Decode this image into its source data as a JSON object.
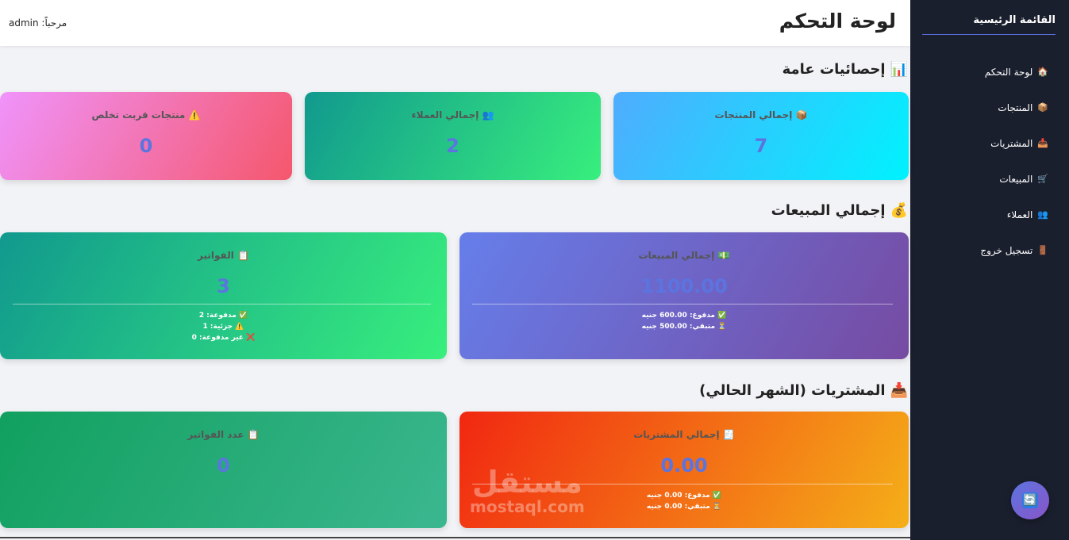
{
  "sidebar": {
    "title": "القائمة الرئيسية",
    "items": [
      {
        "icon": "🏠",
        "label": "لوحة التحكم"
      },
      {
        "icon": "📦",
        "label": "المنتجات"
      },
      {
        "icon": "📥",
        "label": "المشتريات"
      },
      {
        "icon": "🛒",
        "label": "المبيعات"
      },
      {
        "icon": "👥",
        "label": "العملاء"
      },
      {
        "icon": "🚪",
        "label": "تسجيل خروج"
      }
    ]
  },
  "header": {
    "title": "لوحة التحكم",
    "welcome": "مرحباً: admin"
  },
  "stats": {
    "title": "إحصائيات عامة",
    "icon": "📊",
    "products": {
      "icon": "📦",
      "label": "إجمالي المنتجات",
      "value": "7"
    },
    "customers": {
      "icon": "👥",
      "label": "إجمالي العملاء",
      "value": "2"
    },
    "low_stock": {
      "icon": "⚠️",
      "label": "منتجات قربت تخلص",
      "value": "0"
    }
  },
  "sales": {
    "title": "إجمالي المبيعات",
    "icon": "💰",
    "total": {
      "icon": "💵",
      "label": "إجمالي المبيعات",
      "value": "1100.00",
      "paid": "✅ مدفوع: 600.00 جنيه",
      "remaining": "⏳ متبقي: 500.00 جنيه"
    },
    "invoices": {
      "icon": "📋",
      "label": "الفواتير",
      "value": "3",
      "paid": "✅ مدفوعة: 2",
      "partial": "⚠️ جزئية: 1",
      "unpaid": "❌ غير مدفوعة: 0"
    }
  },
  "purchases": {
    "title": "المشتريات (الشهر الحالي)",
    "icon": "📥",
    "total": {
      "icon": "🧾",
      "label": "إجمالي المشتريات",
      "value": "0.00",
      "paid": "✅ مدفوع: 0.00 جنيه",
      "remaining": "⏳ متبقي: 0.00 جنيه"
    },
    "invoices": {
      "icon": "📋",
      "label": "عدد الفواتير",
      "value": "0"
    }
  },
  "watermark": {
    "line1": "مستقل",
    "line2": "mostaql.com"
  },
  "refresh_icon": "🔄"
}
